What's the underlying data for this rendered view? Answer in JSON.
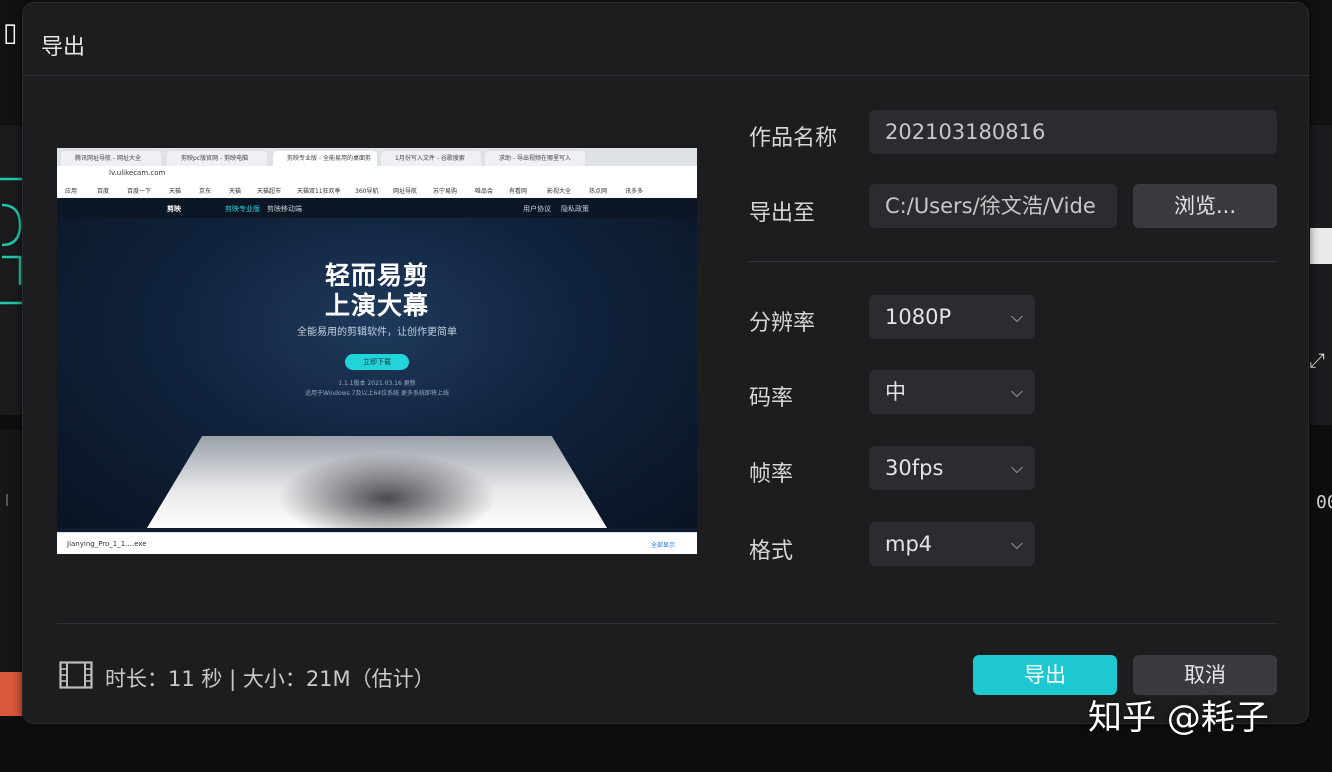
{
  "background": {
    "left_logo": "▯",
    "right_icon": "⤢",
    "right_text": "00"
  },
  "dialog": {
    "title": "导出"
  },
  "preview": {
    "tabs": [
      "腾讯网址导航 - 网址大全",
      "剪映pc版官网 - 剪映电脑",
      "剪映专业版 - 全能易用的桌面剪",
      "1月份写入文件 - 谷歌搜索",
      "求助 - 导出视频在哪里写入"
    ],
    "address": "lv.ulikecam.com",
    "bookmarks": [
      "应用",
      "百度",
      "百度一下",
      "天猫",
      "京东",
      "天猫",
      "天猫超市",
      "天猫双11狂欢季",
      "360导航",
      "网址导航",
      "苏宁易购",
      "唯品会",
      "有看网",
      "影视大全",
      "热点网",
      "讯多多"
    ],
    "nav": {
      "logo": "剪映",
      "items": [
        "剪映专业版",
        "剪映移动端",
        "用户协议",
        "隐私政策"
      ]
    },
    "hero": {
      "line1": "轻而易剪",
      "line2": "上演大幕",
      "subtitle": "全能易用的剪辑软件，让创作更简单",
      "button": "立即下载",
      "version1": "1.1.1版本 2021.03.16 更新",
      "version2": "适用于Windows 7及以上64位系统  更多系统即将上线"
    },
    "download_file": "Jianying_Pro_1_1....exe",
    "download_right": "全部显示"
  },
  "form": {
    "name_label": "作品名称",
    "name_value": "202103180816",
    "export_to_label": "导出至",
    "export_path": "C:/Users/徐文浩/Vide",
    "browse_label": "浏览...",
    "resolution_label": "分辨率",
    "resolution_value": "1080P",
    "bitrate_label": "码率",
    "bitrate_value": "中",
    "framerate_label": "帧率",
    "framerate_value": "30fps",
    "format_label": "格式",
    "format_value": "mp4"
  },
  "footer": {
    "info": "时长：11 秒  |  大小：21M（估计）",
    "export_label": "导出",
    "cancel_label": "取消"
  },
  "watermark": "知乎 @耗子",
  "colors": {
    "accent": "#1ec8d1",
    "dialog_bg": "#1d1d1f",
    "input_bg": "#2c2c30"
  }
}
